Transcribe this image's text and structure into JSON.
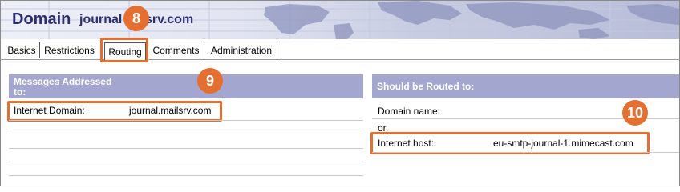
{
  "header": {
    "title": "Domain",
    "domain_name_left": "journal",
    "domain_name_right": "srv.com"
  },
  "callouts": {
    "routing_tab": "8",
    "messages_section": "9",
    "internet_host": "10"
  },
  "tabs": [
    {
      "label": "Basics"
    },
    {
      "label": "Restrictions"
    },
    {
      "label": "Routing",
      "active": true
    },
    {
      "label": "Comments"
    },
    {
      "label": "Administration"
    }
  ],
  "left_section": {
    "title_line1": "Messages Addressed",
    "title_line2": "to:",
    "fields": [
      {
        "label": "Internet Domain:",
        "value": "journal.mailsrv.com"
      }
    ]
  },
  "right_section": {
    "title": "Should be Routed to:",
    "domain_name_label": "Domain name:",
    "or_text": "or.",
    "internet_host_label": "Internet host:",
    "internet_host_value": "eu-smtp-journal-1.mimecast.com"
  },
  "colors": {
    "accent": "#e46f30",
    "section_header": "#a3a7cf",
    "title_text": "#2b2f6e"
  }
}
